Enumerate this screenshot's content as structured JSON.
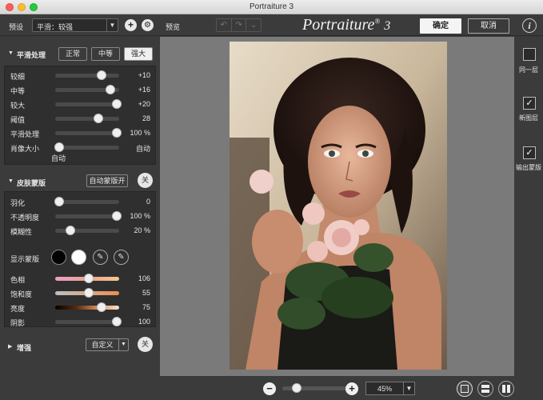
{
  "window": {
    "title": "Portraiture 3"
  },
  "toolbar": {
    "preset_label": "预设",
    "preset_value": "平滑：较强",
    "preview_label": "预览",
    "logo_text": "Portraiture",
    "logo_reg": "®",
    "logo_version": "3",
    "ok_label": "确定",
    "cancel_label": "取消",
    "info_label": "i",
    "add_icon": "plus-icon",
    "settings_icon": "gear-icon"
  },
  "smoothing": {
    "title": "平滑处理",
    "levels": [
      "正常",
      "中等",
      "强大"
    ],
    "active_level": 2,
    "sliders": [
      {
        "name": "较细",
        "value": "+10",
        "pos": 0.72
      },
      {
        "name": "中等",
        "value": "+16",
        "pos": 0.86
      },
      {
        "name": "较大",
        "value": "+20",
        "pos": 0.96
      },
      {
        "name": "阈值",
        "value": "28",
        "pos": 0.68
      },
      {
        "name": "平滑处理",
        "value": "100 %",
        "pos": 0.96
      },
      {
        "name": "肖像大小",
        "value": "自动",
        "pos": 0.06
      }
    ],
    "auto_label": "自动"
  },
  "skin_mask": {
    "title": "皮肤蒙版",
    "auto_mask_label": "自动蒙版开",
    "off_label": "关",
    "sliders": [
      {
        "name": "羽化",
        "value": "0",
        "pos": 0.06
      },
      {
        "name": "不透明度",
        "value": "100 %",
        "pos": 0.96
      },
      {
        "name": "模糊性",
        "value": "20 %",
        "pos": 0.24
      }
    ],
    "show_mask_label": "显示蒙版",
    "color_sliders": [
      {
        "name": "色相",
        "value": "106",
        "pos": 0.52,
        "gradient": "linear-gradient(90deg,#e9a0c8,#f0a090,#f4c890)"
      },
      {
        "name": "饱和度",
        "value": "55",
        "pos": 0.52,
        "gradient": "linear-gradient(90deg,#bfbfbf,#d8a888,#f08c50)"
      },
      {
        "name": "亮度",
        "value": "75",
        "pos": 0.72,
        "gradient": "linear-gradient(90deg,#000000,#5a2a10,#d89060,#ffe0c8)"
      },
      {
        "name": "阴影",
        "value": "100",
        "pos": 0.96,
        "gradient": "#4a4a4a"
      }
    ]
  },
  "enhance": {
    "title": "增强",
    "custom_label": "自定义",
    "off_label": "关"
  },
  "right_panel": {
    "items": [
      {
        "label": "同一层",
        "checked": false
      },
      {
        "label": "新图层",
        "checked": true
      },
      {
        "label": "输出蒙版",
        "checked": true
      }
    ]
  },
  "bottom": {
    "zoom_value": "45%",
    "zoom_pos": 0.22
  }
}
